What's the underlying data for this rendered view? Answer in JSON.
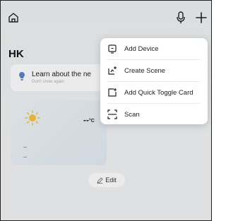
{
  "home": {
    "name": "HK"
  },
  "banner": {
    "title": "Learn about the ne",
    "subtitle": "Don't show again"
  },
  "weather": {
    "temperature": "--",
    "unit": "°C"
  },
  "edit": {
    "label": "Edit"
  },
  "menu": {
    "items": [
      {
        "label": "Add Device",
        "icon": "device-icon"
      },
      {
        "label": "Create Scene",
        "icon": "scene-icon"
      },
      {
        "label": "Add Quick Toggle Card",
        "icon": "toggle-card-icon"
      },
      {
        "label": "Scan",
        "icon": "scan-icon"
      }
    ]
  },
  "colors": {
    "background": "#eef1f4",
    "card": "#ffffff",
    "banner_icon": "#5b86c9",
    "sun": "#f4c542"
  }
}
